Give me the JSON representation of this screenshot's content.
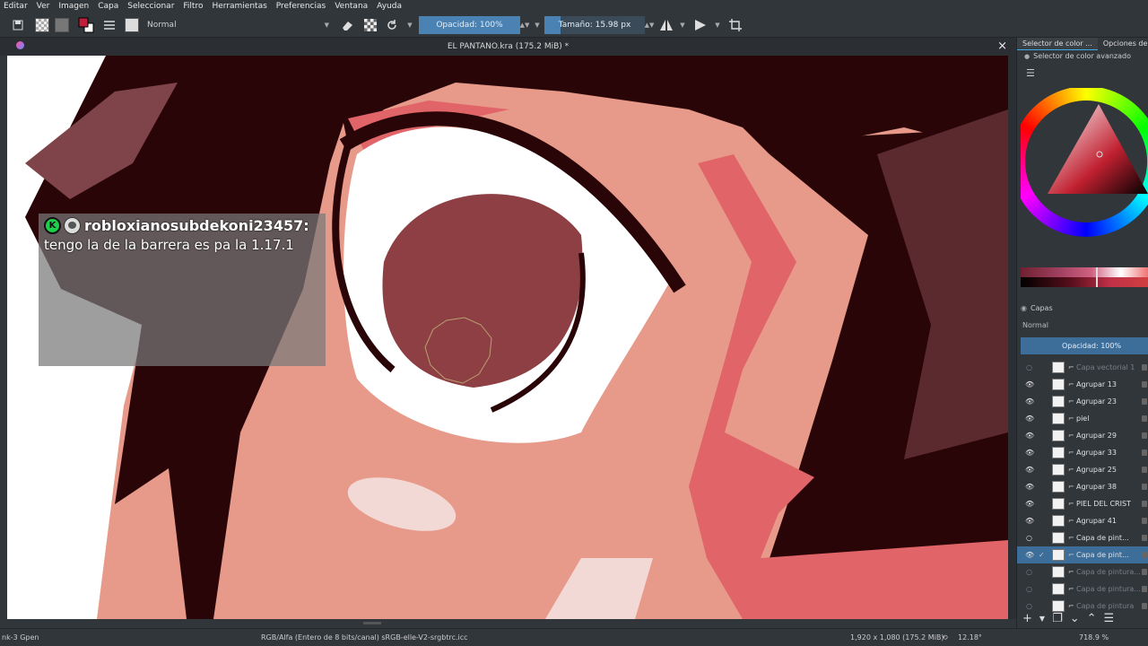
{
  "menu": [
    "Editar",
    "Ver",
    "Imagen",
    "Capa",
    "Seleccionar",
    "Filtro",
    "Herramientas",
    "Preferencias",
    "Ventana",
    "Ayuda"
  ],
  "toolbar": {
    "blend_mode": "Normal",
    "opacity_label": "Opacidad: 100%",
    "opacity_value": 1.0,
    "size_label": "Tamaño: 15.98 px"
  },
  "document": {
    "title": "EL PANTANO.kra (175.2 MiB) *",
    "close": "×"
  },
  "chat": {
    "badge": "K",
    "username": "robloxianosubdekoni23457:",
    "message": "tengo la de la barrera es pa la 1.17.1"
  },
  "dock": {
    "tabs": [
      "Selector de color ...",
      "Opciones de"
    ],
    "subtitle": "Selector de color avanzado",
    "layers_title": "Capas",
    "layers_blend": "Normal",
    "layers_opacity": "Opacidad:  100%"
  },
  "layers": [
    {
      "name": "Capa vectorial 1",
      "visible": false,
      "dim": true,
      "selected": false
    },
    {
      "name": "Agrupar 13",
      "visible": true,
      "dim": false,
      "selected": false
    },
    {
      "name": "Agrupar 23",
      "visible": true,
      "dim": false,
      "selected": false
    },
    {
      "name": "piel",
      "visible": true,
      "dim": false,
      "selected": false
    },
    {
      "name": "Agrupar 29",
      "visible": true,
      "dim": false,
      "selected": false
    },
    {
      "name": "Agrupar 33",
      "visible": true,
      "dim": false,
      "selected": false
    },
    {
      "name": "Agrupar 25",
      "visible": true,
      "dim": false,
      "selected": false
    },
    {
      "name": "Agrupar 38",
      "visible": true,
      "dim": false,
      "selected": false
    },
    {
      "name": "PIEL DEL CRIST",
      "visible": true,
      "dim": false,
      "selected": false
    },
    {
      "name": "Agrupar 41",
      "visible": true,
      "dim": false,
      "selected": false
    },
    {
      "name": "Capa de pint...",
      "visible": false,
      "dim": false,
      "selected": false
    },
    {
      "name": "Capa de pint...",
      "visible": true,
      "dim": false,
      "selected": true
    },
    {
      "name": "Capa de pintura...",
      "visible": false,
      "dim": true,
      "selected": false
    },
    {
      "name": "Capa de pintura...",
      "visible": false,
      "dim": true,
      "selected": false
    },
    {
      "name": "Capa de pintura",
      "visible": false,
      "dim": true,
      "selected": false
    }
  ],
  "status": {
    "brush": "nk-3 Gpen",
    "color_model": "RGB/Alfa (Entero de 8 bits/canal)  sRGB-elle-V2-srgbtrc.icc",
    "image_size": "1,920 x 1,080 (175.2 MiB)",
    "rotation": "12.18°",
    "zoom": "718.9 %"
  },
  "colors": {
    "skin": "#e79a8a",
    "hair": "#2a0508",
    "iris": "#8e3f44",
    "accent": "#3d6e9a"
  }
}
